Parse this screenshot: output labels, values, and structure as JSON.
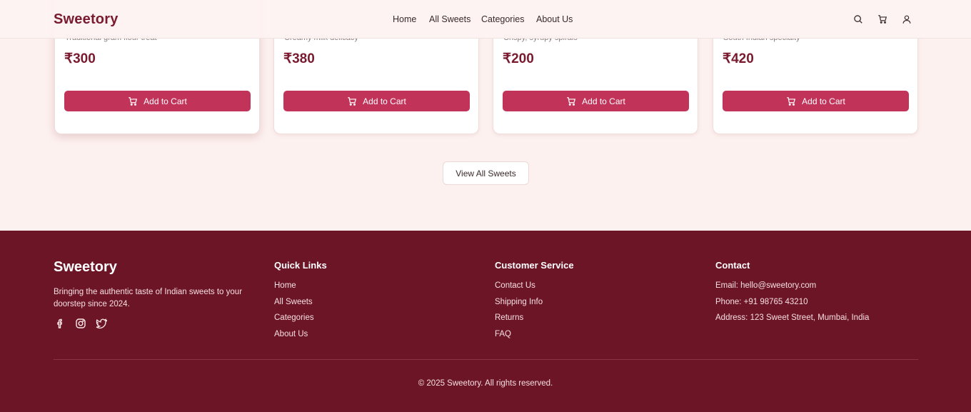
{
  "header": {
    "logo": "Sweetory",
    "nav": [
      "Home",
      "All Sweets",
      "Categories",
      "About Us"
    ],
    "icons": [
      "search-icon",
      "cart-icon",
      "user-icon"
    ]
  },
  "products": [
    {
      "desc": "Traditional gram flour treat",
      "price": "₹300",
      "button": "Add to Cart"
    },
    {
      "desc": "Creamy milk delicacy",
      "price": "₹380",
      "button": "Add to Cart"
    },
    {
      "desc": "Crispy, syrupy spirals",
      "price": "₹200",
      "button": "Add to Cart"
    },
    {
      "desc": "South Indian specialty",
      "price": "₹420",
      "button": "Add to Cart"
    }
  ],
  "view_all": "View All Sweets",
  "footer": {
    "logo": "Sweetory",
    "about": "Bringing the authentic taste of Indian sweets to your doorstep since 2024.",
    "socials": [
      "facebook-icon",
      "instagram-icon",
      "twitter-icon"
    ],
    "quick_links": {
      "title": "Quick Links",
      "items": [
        "Home",
        "All Sweets",
        "Categories",
        "About Us"
      ]
    },
    "customer_service": {
      "title": "Customer Service",
      "items": [
        "Contact Us",
        "Shipping Info",
        "Returns",
        "FAQ"
      ]
    },
    "contact": {
      "title": "Contact",
      "items": [
        "Email: hello@sweetory.com",
        "Phone: +91 98765 43210",
        "Address: 123 Sweet Street, Mumbai, India"
      ]
    },
    "copyright": "© 2025 Sweetory. All rights reserved."
  },
  "colors": {
    "brand": "#7a1a2e",
    "button": "#c2335a",
    "footer_bg": "#6c1527",
    "page_bg": "#fdf1ef"
  }
}
